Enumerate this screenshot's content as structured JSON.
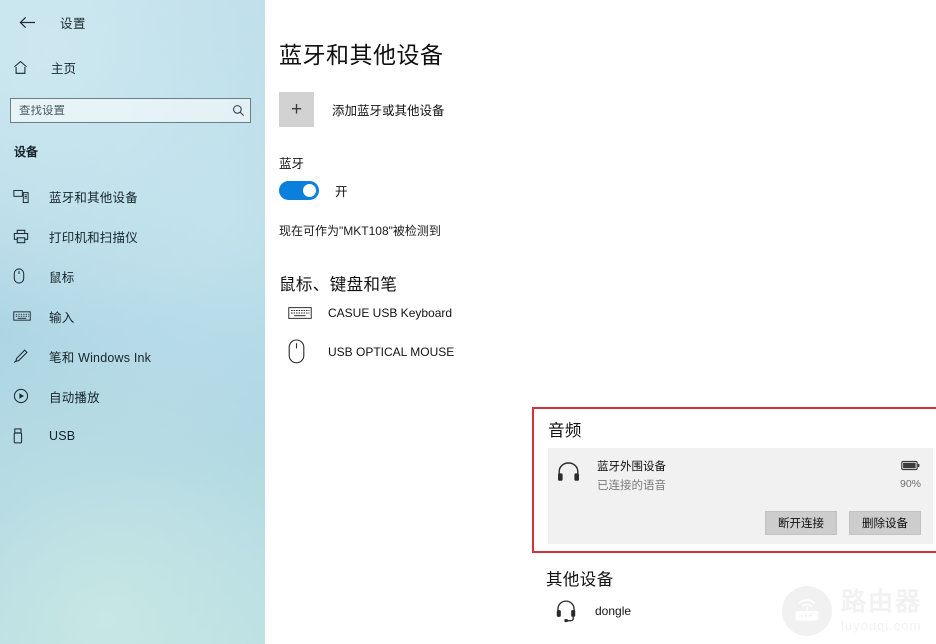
{
  "window": {
    "title": "设置",
    "back_icon": "back-arrow-icon"
  },
  "sidebar": {
    "home_label": "主页",
    "home_icon": "home-icon",
    "search": {
      "placeholder": "查找设置",
      "value": "",
      "icon": "search-icon"
    },
    "section_title": "设备",
    "items": [
      {
        "label": "蓝牙和其他设备",
        "icon": "bluetooth-device-icon",
        "selected": true
      },
      {
        "label": "打印机和扫描仪",
        "icon": "printer-icon",
        "selected": false
      },
      {
        "label": "鼠标",
        "icon": "mouse-icon",
        "selected": false
      },
      {
        "label": "输入",
        "icon": "keyboard-icon",
        "selected": false
      },
      {
        "label": "笔和 Windows Ink",
        "icon": "pen-icon",
        "selected": false
      },
      {
        "label": "自动播放",
        "icon": "autoplay-icon",
        "selected": false
      },
      {
        "label": "USB",
        "icon": "usb-icon",
        "selected": false
      }
    ]
  },
  "main": {
    "page_title": "蓝牙和其他设备",
    "add_device": {
      "label": "添加蓝牙或其他设备",
      "icon": "plus-icon"
    },
    "bluetooth": {
      "label": "蓝牙",
      "toggle_state": "开",
      "toggle_on": true,
      "accent_color": "#0a7fdc",
      "discoverable_text": "现在可作为\"MKT108\"被检测到"
    },
    "mouse_keyboard_section": {
      "heading": "鼠标、键盘和笔",
      "devices": [
        {
          "name": "CASUE USB Keyboard",
          "icon": "keyboard-icon"
        },
        {
          "name": "USB OPTICAL MOUSE",
          "icon": "mouse-icon"
        }
      ]
    },
    "audio_section": {
      "heading": "音频",
      "highlight_color": "#d0343a",
      "device": {
        "name": "蓝牙外围设备",
        "status": "已连接的语音",
        "icon": "headphones-icon",
        "battery_icon": "battery-icon",
        "battery_percent": "90%"
      },
      "actions": [
        {
          "label": "断开连接"
        },
        {
          "label": "删除设备"
        }
      ]
    },
    "other_section": {
      "heading": "其他设备",
      "devices": [
        {
          "name": "dongle",
          "icon": "headset-icon"
        }
      ]
    }
  },
  "watermark": {
    "cn": "路由器",
    "en": "luyouqi.com",
    "icon": "router-icon"
  }
}
